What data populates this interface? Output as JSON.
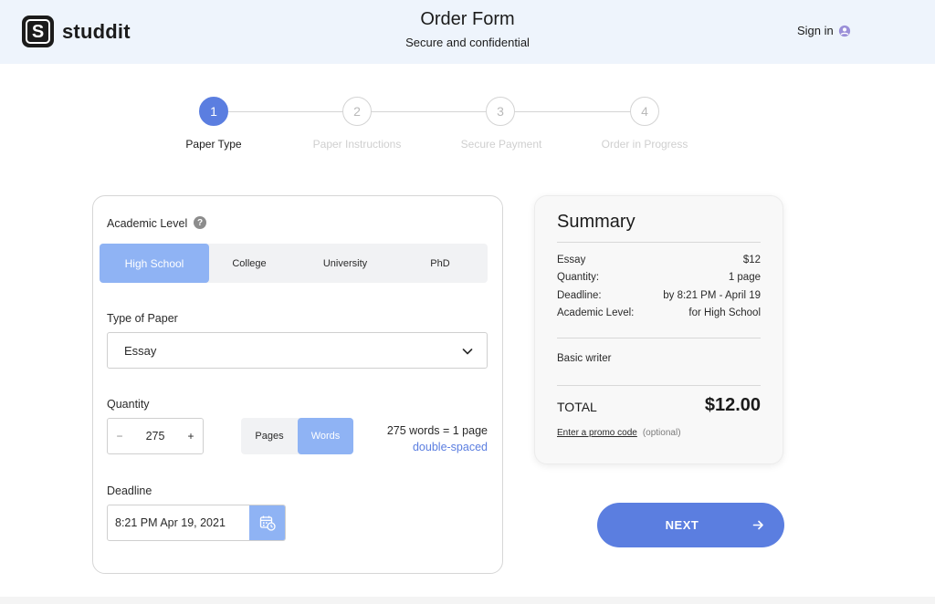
{
  "header": {
    "brand": "studdit",
    "logo_letter": "S",
    "title": "Order Form",
    "subtitle": "Secure and confidential",
    "signin_label": "Sign in"
  },
  "steps": [
    {
      "number": "1",
      "label": "Paper Type",
      "active": true
    },
    {
      "number": "2",
      "label": "Paper Instructions",
      "active": false
    },
    {
      "number": "3",
      "label": "Secure Payment",
      "active": false
    },
    {
      "number": "4",
      "label": "Order in Progress",
      "active": false
    }
  ],
  "form": {
    "academic_level_label": "Academic Level",
    "help_symbol": "?",
    "levels": [
      "High School",
      "College",
      "University",
      "PhD"
    ],
    "selected_level": "High School",
    "type_label": "Type of Paper",
    "type_value": "Essay",
    "quantity_label": "Quantity",
    "quantity_minus": "−",
    "quantity_value": "275",
    "quantity_plus": "+",
    "units": [
      "Pages",
      "Words"
    ],
    "selected_unit": "Words",
    "words_note": "275 words = 1 page",
    "spacing_link": "double-spaced",
    "deadline_label": "Deadline",
    "deadline_value": "8:21 PM Apr 19, 2021"
  },
  "summary": {
    "title": "Summary",
    "rows": [
      {
        "label": "Essay",
        "value": "$12"
      },
      {
        "label": "Quantity:",
        "value": "1 page"
      },
      {
        "label": "Deadline:",
        "value": "by 8:21 PM - April 19"
      },
      {
        "label": "Academic Level:",
        "value": "for High School"
      }
    ],
    "writer": "Basic writer",
    "total_label": "TOTAL",
    "total_value": "$12.00",
    "promo_link": "Enter a promo code",
    "promo_optional": "(optional)"
  },
  "next_button": {
    "label": "NEXT"
  },
  "colors": {
    "accent": "#5b7ee0",
    "accent_light": "#8fb3f4",
    "header_bg": "#eef4fc"
  },
  "icons": {
    "logo": "studdit-logo-icon",
    "user": "user-circle-icon",
    "help": "question-icon",
    "chevron": "chevron-down-icon",
    "calendar": "calendar-clock-icon",
    "arrow": "arrow-right-icon"
  }
}
